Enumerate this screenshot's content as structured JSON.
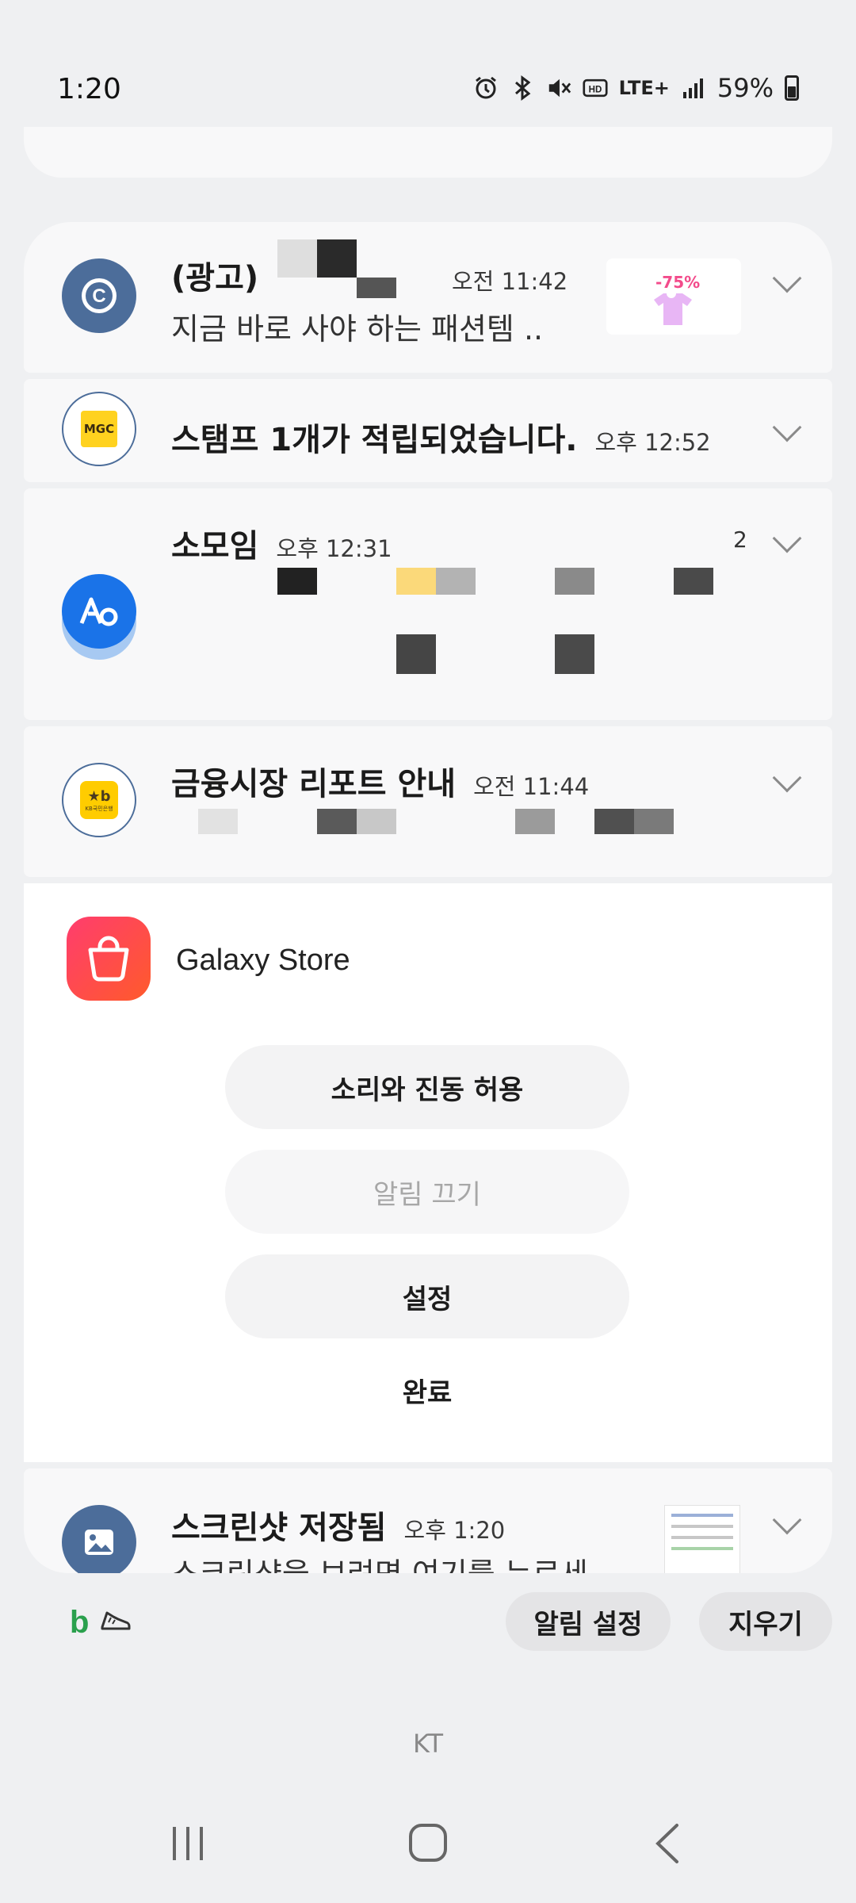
{
  "status_bar": {
    "time": "1:20",
    "network": "LTE+",
    "battery": "59%",
    "icons": [
      "alarm-icon",
      "bluetooth-icon",
      "mute-icon",
      "hd-voice-icon",
      "lte-icon",
      "signal-icon",
      "battery-icon"
    ]
  },
  "notifications": [
    {
      "app": "ad",
      "title": "(광고)",
      "time": "오전 11:42",
      "body": "지금 바로 사야 하는 패션템 ..",
      "thumbnail_text": "-75%",
      "icon": "c-circle-icon"
    },
    {
      "app": "mega-coffee",
      "title": "스탬프 1개가 적립되었습니다.",
      "time": "오후 12:52",
      "icon": "mega-coffee-icon"
    },
    {
      "app": "somoim",
      "title": "소모임",
      "time": "오후 12:31",
      "count": "2",
      "icon": "somoim-icon"
    },
    {
      "app": "kb",
      "title": "금융시장 리포트 안내",
      "time": "오전 11:44",
      "icon": "kb-bank-icon"
    },
    {
      "app": "screenshot",
      "title": "스크린샷 저장됨",
      "time": "오후 1:20",
      "body": "스크린샷을 보려면 여기를 누르세",
      "icon": "gallery-icon"
    }
  ],
  "panel": {
    "app_name": "Galaxy Store",
    "buttons": {
      "allow_sound": "소리와 진동 허용",
      "turn_off": "알림 끄기",
      "settings": "설정",
      "done": "완료"
    }
  },
  "bottom_actions": {
    "notification_settings": "알림 설정",
    "clear": "지우기"
  },
  "carrier": "KT",
  "colors": {
    "galaxy_store_gradient_start": "#ff3d6e",
    "galaxy_store_gradient_end": "#ff5a2b",
    "kb_yellow": "#ffcc00",
    "somoim_blue": "#1a73e8",
    "ad_icon_blue": "#4c6d9a"
  }
}
